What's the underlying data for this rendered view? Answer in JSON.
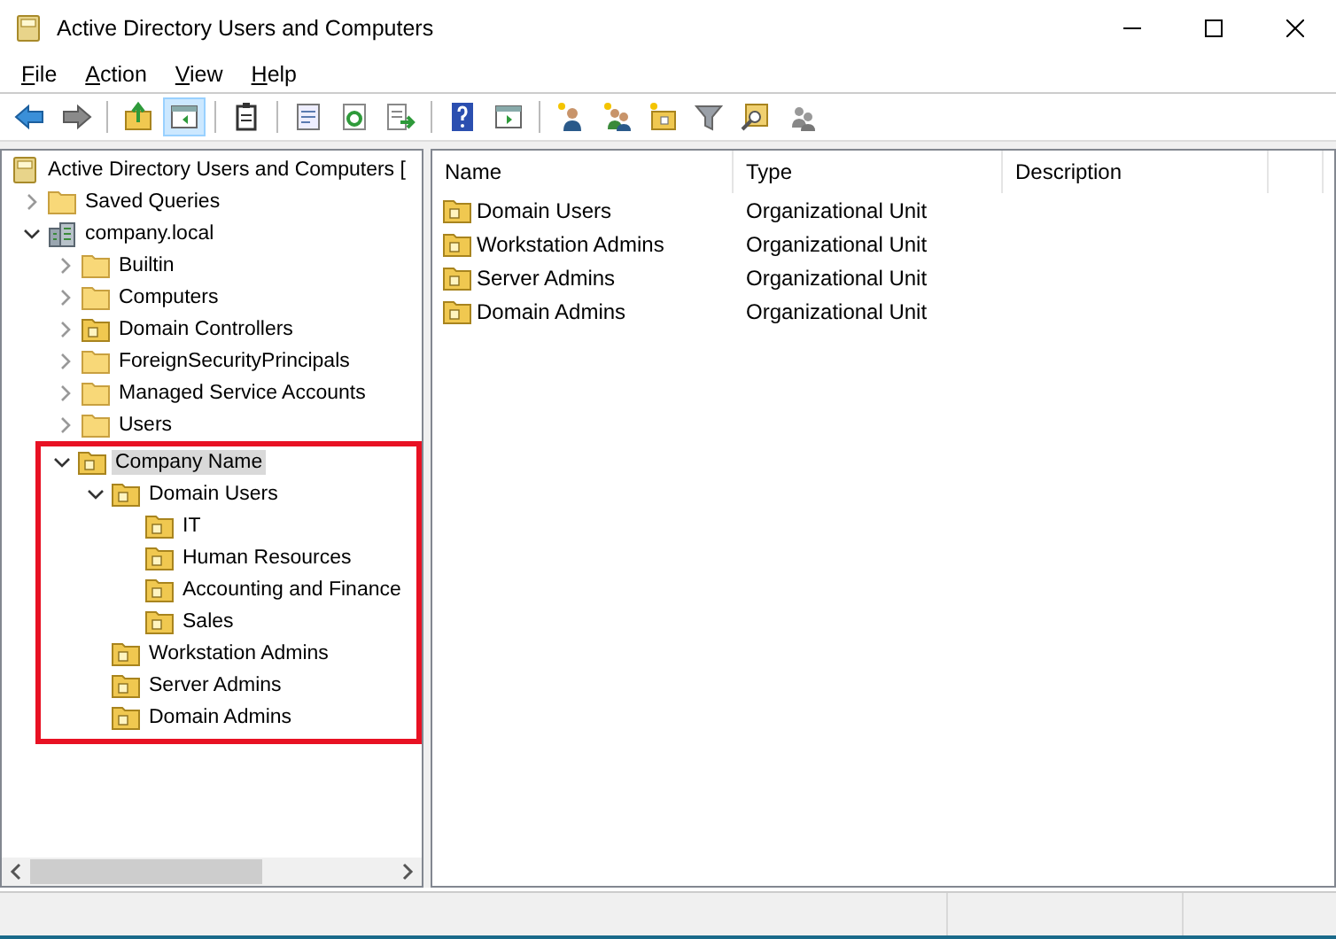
{
  "window": {
    "title": "Active Directory Users and Computers"
  },
  "menu": [
    "File",
    "Action",
    "View",
    "Help"
  ],
  "toolbar": [
    {
      "kind": "back"
    },
    {
      "kind": "forward"
    },
    {
      "kind": "separator"
    },
    {
      "kind": "up-folder"
    },
    {
      "kind": "console-tree",
      "pressed": true
    },
    {
      "kind": "separator"
    },
    {
      "kind": "clipboard"
    },
    {
      "kind": "separator"
    },
    {
      "kind": "properties"
    },
    {
      "kind": "refresh"
    },
    {
      "kind": "export"
    },
    {
      "kind": "separator"
    },
    {
      "kind": "help"
    },
    {
      "kind": "action-pane"
    },
    {
      "kind": "separator"
    },
    {
      "kind": "new-user"
    },
    {
      "kind": "new-group"
    },
    {
      "kind": "new-ou"
    },
    {
      "kind": "filter"
    },
    {
      "kind": "find"
    },
    {
      "kind": "add-to-group"
    }
  ],
  "tree": {
    "items": [
      {
        "label": "Active Directory Users and Computers [",
        "kind": "snapin",
        "selected": false,
        "children": [
          {
            "label": "Saved Queries",
            "kind": "folder",
            "expanded": false,
            "selected": false
          },
          {
            "label": "company.local",
            "kind": "domain",
            "expanded": true,
            "selected": false,
            "children": [
              {
                "label": "Builtin",
                "kind": "folder",
                "expanded": false,
                "selected": false
              },
              {
                "label": "Computers",
                "kind": "folder",
                "expanded": false,
                "selected": false
              },
              {
                "label": "Domain Controllers",
                "kind": "ou",
                "expanded": false,
                "selected": false
              },
              {
                "label": "ForeignSecurityPrincipals",
                "kind": "folder",
                "expanded": false,
                "selected": false
              },
              {
                "label": "Managed Service Accounts",
                "kind": "folder",
                "expanded": false,
                "selected": false
              },
              {
                "label": "Users",
                "kind": "folder",
                "expanded": false,
                "selected": false
              },
              {
                "label": "Company Name",
                "kind": "ou",
                "expanded": true,
                "selected": true,
                "highlighted": true,
                "children": [
                  {
                    "label": "Domain Users",
                    "kind": "ou",
                    "expanded": true,
                    "selected": false,
                    "children": [
                      {
                        "label": "IT",
                        "kind": "ou",
                        "selected": false
                      },
                      {
                        "label": "Human Resources",
                        "kind": "ou",
                        "selected": false
                      },
                      {
                        "label": "Accounting and Finance",
                        "kind": "ou",
                        "selected": false
                      },
                      {
                        "label": "Sales",
                        "kind": "ou",
                        "selected": false
                      }
                    ]
                  },
                  {
                    "label": "Workstation Admins",
                    "kind": "ou",
                    "selected": false
                  },
                  {
                    "label": "Server Admins",
                    "kind": "ou",
                    "selected": false
                  },
                  {
                    "label": "Domain Admins",
                    "kind": "ou",
                    "selected": false
                  }
                ]
              }
            ]
          }
        ]
      }
    ]
  },
  "list": {
    "columns": [
      "Name",
      "Type",
      "Description"
    ],
    "rows": [
      {
        "name": "Domain Users",
        "type": "Organizational Unit"
      },
      {
        "name": "Workstation Admins",
        "type": "Organizational Unit"
      },
      {
        "name": "Server Admins",
        "type": "Organizational Unit"
      },
      {
        "name": "Domain Admins",
        "type": "Organizational Unit"
      }
    ]
  }
}
